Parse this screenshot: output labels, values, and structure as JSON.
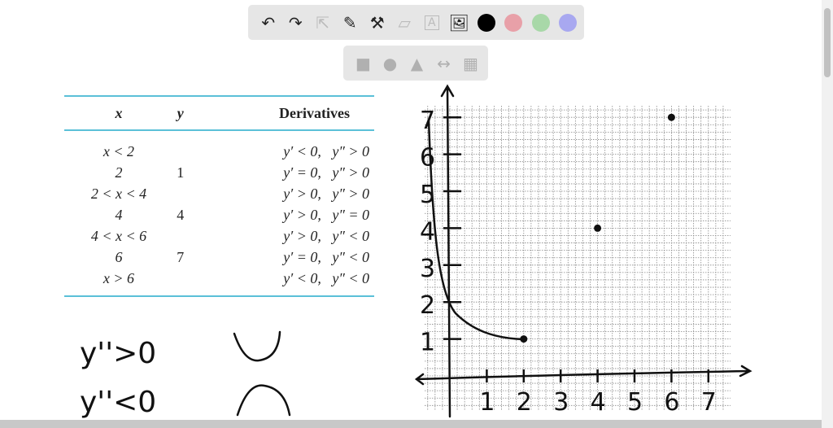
{
  "toolbar": {
    "tools": [
      "undo-icon",
      "redo-icon",
      "pointer-icon",
      "pen-icon",
      "tools-icon",
      "eraser-icon",
      "text-icon",
      "image-icon"
    ],
    "colors": [
      "#000000",
      "#e8a0a8",
      "#a8d8a8",
      "#a8a8f0"
    ]
  },
  "shape_toolbar": {
    "tools": [
      "square-icon",
      "circle-icon",
      "triangle-icon",
      "arrow-icon",
      "grid-icon"
    ]
  },
  "table": {
    "headers": [
      "x",
      "y",
      "Derivatives"
    ],
    "rows": [
      [
        "x < 2",
        "",
        "y′ < 0,   y″ > 0"
      ],
      [
        "2",
        "1",
        "y′ = 0,   y″ > 0"
      ],
      [
        "2 < x < 4",
        "",
        "y′ > 0,   y″ > 0"
      ],
      [
        "4",
        "4",
        "y′ > 0,   y″ = 0"
      ],
      [
        "4 < x < 6",
        "",
        "y′ > 0,   y″ < 0"
      ],
      [
        "6",
        "7",
        "y′ = 0,   y″ < 0"
      ],
      [
        "x > 6",
        "",
        "y′ < 0,   y″ < 0"
      ]
    ]
  },
  "notes": {
    "concave_up": "y''>0",
    "concave_down": "y''<0"
  },
  "graph": {
    "x_ticks": [
      "1",
      "2",
      "3",
      "4",
      "5",
      "6",
      "7"
    ],
    "y_ticks": [
      "1",
      "2",
      "3",
      "4",
      "5",
      "6",
      "7"
    ],
    "points": [
      [
        2,
        1
      ],
      [
        4,
        4
      ],
      [
        6,
        7
      ]
    ]
  }
}
